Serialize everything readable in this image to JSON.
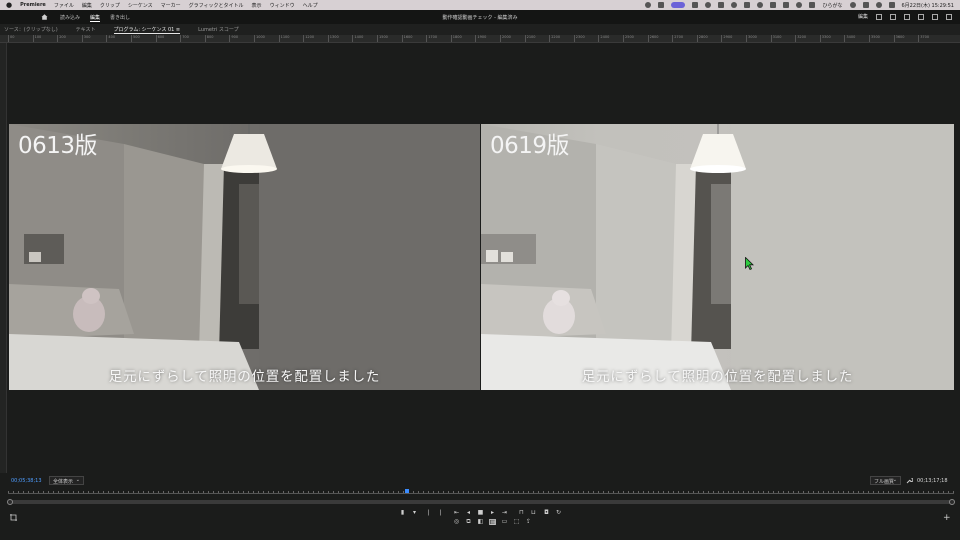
{
  "menubar": {
    "app_name": "Premiere",
    "items": [
      "ファイル",
      "編集",
      "クリップ",
      "シーケンス",
      "マーカー",
      "グラフィックとタイトル",
      "表示",
      "ウィンドウ",
      "ヘルプ"
    ],
    "user_label": "ひらがな",
    "datetime": "6月22日(木)  15:29:51"
  },
  "header": {
    "workspace_tabs": [
      "読み込み",
      "編集",
      "書き出し"
    ],
    "active_tab": "編集",
    "document_title": "動作確認動画チェック - 編集済み",
    "right_label": "編集"
  },
  "panel_tabs": [
    "ソース：(クリップなし)",
    "テキスト",
    "プログラム: シーケンス 01  ≡",
    "Lumetri スコープ"
  ],
  "ruler_labels": [
    "00",
    "100",
    "200",
    "300",
    "400",
    "500",
    "600",
    "700",
    "800",
    "900",
    "1000",
    "1100",
    "1200",
    "1300",
    "1400",
    "1500",
    "1600",
    "1700",
    "1800",
    "1900",
    "2000",
    "2100",
    "2200",
    "2300",
    "2400",
    "2500",
    "2600",
    "2700",
    "2800",
    "2900",
    "3000",
    "3100",
    "3200",
    "3300",
    "3400",
    "3500",
    "3600",
    "3700"
  ],
  "frames": [
    {
      "label": "0613版",
      "subtitle": "足元にずらして照明の位置を配置しました"
    },
    {
      "label": "0619版",
      "subtitle": "足元にずらして照明の位置を配置しました"
    }
  ],
  "footer": {
    "timecode_current": "00;05;38;13",
    "fit_option": "全体表示",
    "quality_option": "フル画質",
    "timecode_duration": "00;13;17;18"
  },
  "colors": {
    "accent_blue": "#3b8cff",
    "timecode_blue": "#4f9dff",
    "cursor_green": "#2ecc40"
  }
}
